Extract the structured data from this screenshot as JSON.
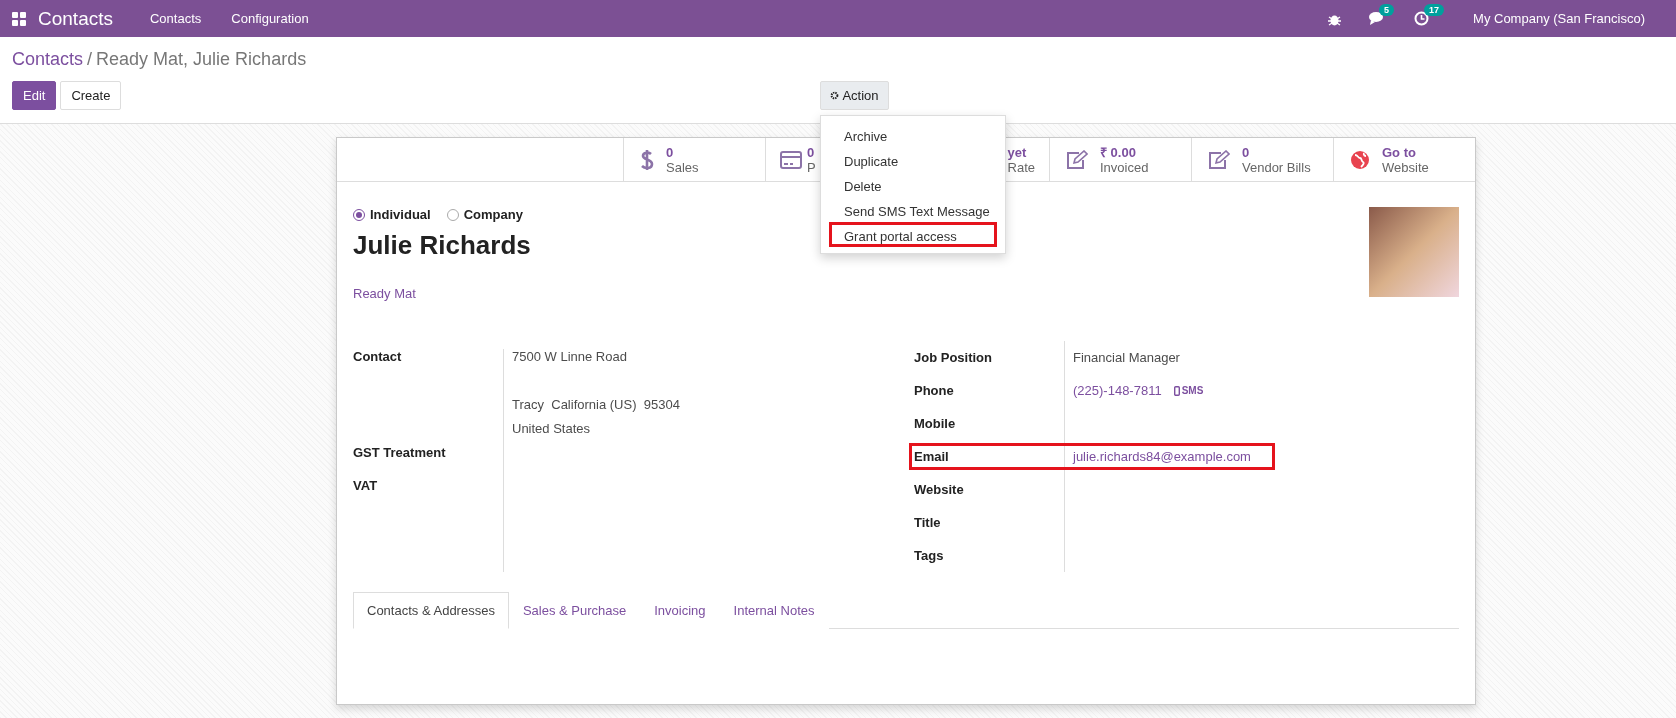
{
  "navbar": {
    "app": "Contacts",
    "menus": [
      "Contacts",
      "Configuration"
    ],
    "chat_count": "5",
    "activity_count": "17",
    "company": "My Company (San Francisco)"
  },
  "breadcrumb": {
    "parent": "Contacts",
    "separator": "/",
    "current": "Ready Mat, Julie Richards"
  },
  "buttons": [
    {
      "label": "Edit",
      "kind": "primary"
    },
    {
      "label": "Create",
      "kind": "secondary"
    }
  ],
  "action": {
    "label": "Action",
    "menu": [
      {
        "label": "Archive",
        "highlighted": false
      },
      {
        "label": "Duplicate",
        "highlighted": false
      },
      {
        "label": "Delete",
        "highlighted": false
      },
      {
        "label": "Send SMS Text Message",
        "highlighted": false
      },
      {
        "label": "Grant portal access",
        "highlighted": true
      }
    ]
  },
  "stats": [
    {
      "kind": "dollar",
      "value": "0",
      "label": "Sales"
    },
    {
      "kind": "card",
      "value": "0",
      "label": "P"
    },
    {
      "kind": "partial",
      "value": "yet",
      "label": "Rate"
    },
    {
      "kind": "pencil",
      "value": "₹ 0.00",
      "label": "Invoiced"
    },
    {
      "kind": "pencil",
      "value": "0",
      "label": "Vendor Bills"
    },
    {
      "kind": "globe",
      "value": "Go to",
      "label": "Website"
    }
  ],
  "contact_type": [
    {
      "label": "Individual",
      "selected": true
    },
    {
      "label": "Company",
      "selected": false
    }
  ],
  "name": "Julie Richards",
  "company_link": "Ready Mat",
  "left_fields": [
    {
      "label": "Contact",
      "address": {
        "street": "7500 W Linne Road",
        "city": "Tracy  California (US)  95304",
        "country": "United States"
      }
    },
    {
      "label": "GST Treatment"
    },
    {
      "label": "VAT"
    }
  ],
  "right_fields": [
    {
      "label": "Job Position",
      "value": "Financial Manager",
      "kind": "text",
      "highlighted": false
    },
    {
      "label": "Phone",
      "value": "(225)-148-7811",
      "kind": "phone",
      "sms": "SMS",
      "highlighted": false
    },
    {
      "label": "Mobile",
      "highlighted": false
    },
    {
      "label": "Email",
      "value": "julie.richards84@example.com",
      "kind": "link",
      "highlighted": true
    },
    {
      "label": "Website",
      "highlighted": false
    },
    {
      "label": "Title",
      "highlighted": false
    },
    {
      "label": "Tags",
      "highlighted": false
    }
  ],
  "tabs": [
    {
      "label": "Contacts & Addresses",
      "selected": true
    },
    {
      "label": "Sales & Purchase",
      "selected": false
    },
    {
      "label": "Invoicing",
      "selected": false
    },
    {
      "label": "Internal Notes",
      "selected": false
    }
  ]
}
